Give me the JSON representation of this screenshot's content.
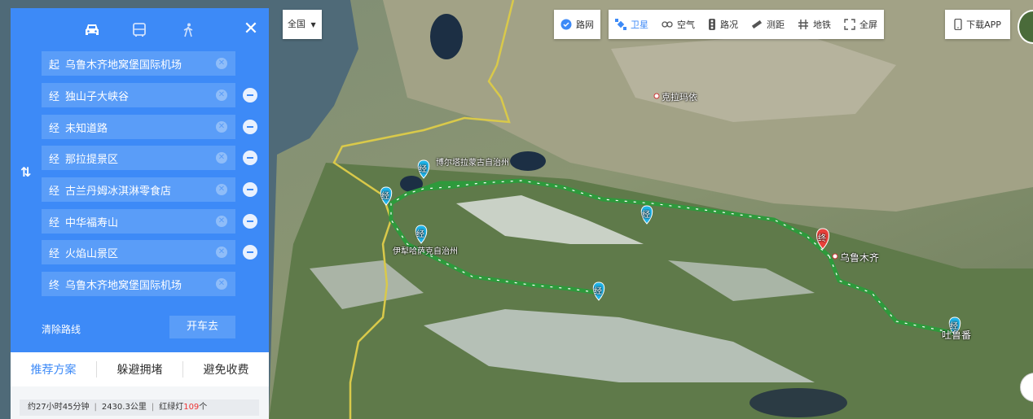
{
  "panel": {
    "modes": [
      {
        "name": "car",
        "icon": "car-icon"
      },
      {
        "name": "bus",
        "icon": "bus-icon"
      },
      {
        "name": "walk",
        "icon": "walk-icon"
      }
    ],
    "close_icon": "close-icon",
    "swap_icon": "swap-icon",
    "waypoints": [
      {
        "prefix": "起",
        "text": "乌鲁木齐地窝堡国际机场",
        "removable": false
      },
      {
        "prefix": "经",
        "text": "独山子大峡谷",
        "removable": true
      },
      {
        "prefix": "经",
        "text": "未知道路",
        "removable": true
      },
      {
        "prefix": "经",
        "text": "那拉提景区",
        "removable": true
      },
      {
        "prefix": "经",
        "text": "古兰丹姆冰淇淋零食店",
        "removable": true
      },
      {
        "prefix": "经",
        "text": "中华福寿山",
        "removable": true
      },
      {
        "prefix": "经",
        "text": "火焰山景区",
        "removable": true
      },
      {
        "prefix": "终",
        "text": "乌鲁木齐地窝堡国际机场",
        "removable": false
      }
    ],
    "clear_label": "清除路线",
    "go_label": "开车去",
    "tabs": [
      "推荐方案",
      "躲避拥堵",
      "避免收费"
    ],
    "summary": {
      "time": "约27小时45分钟",
      "distance": "2430.3公里",
      "lights_prefix": "红绿灯",
      "lights_count": "109",
      "lights_suffix": "个"
    }
  },
  "region": {
    "label": "全国"
  },
  "toolbar": {
    "road_network": "路网",
    "satellite": "卫星",
    "air": "空气",
    "traffic": "路况",
    "measure": "测距",
    "subway": "地铁",
    "fullscreen": "全屏",
    "download_app": "下载APP"
  },
  "map": {
    "labels": {
      "kelamayi": "克拉玛依",
      "boertala": "博尔塔拉蒙古自治州",
      "yili": "伊犁哈萨克自治州",
      "urumqi": "乌鲁木齐",
      "tulufan": "吐鲁番"
    },
    "via_marker": "经",
    "end_marker": "终"
  },
  "colors": {
    "accent": "#3d8af7",
    "route": "#2e9a3c",
    "end_marker": "#e8413b",
    "via_marker": "#1fb3e8"
  }
}
